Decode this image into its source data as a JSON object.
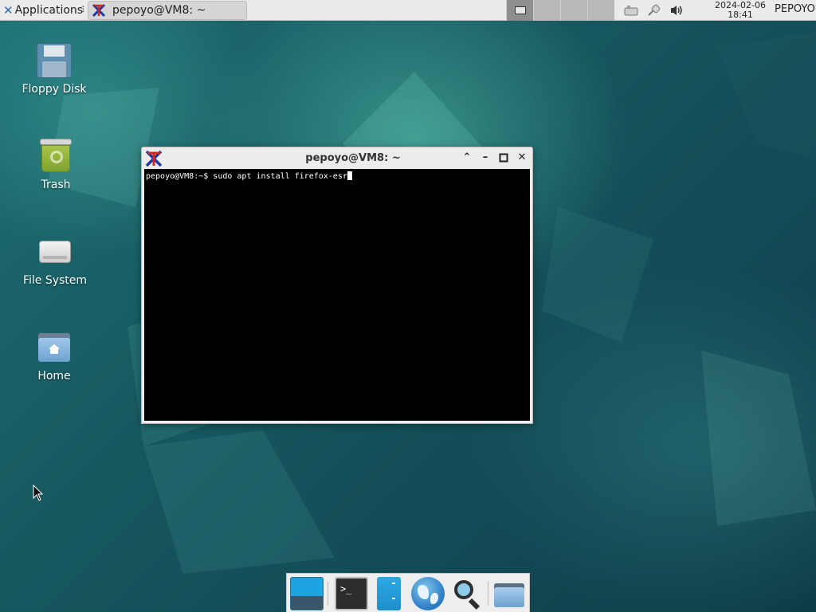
{
  "top_panel": {
    "applications_label": "Applications",
    "applications_separator": "⠇",
    "task_button_title": "pepoyo@VM8: ~",
    "clock": {
      "date": "2024-02-06",
      "time": "18:41"
    },
    "user_label": "PEPOYO"
  },
  "desktop_icons": [
    {
      "label": "Floppy Disk",
      "icon": "floppy-disk-icon"
    },
    {
      "label": "Trash",
      "icon": "trash-icon"
    },
    {
      "label": "File System",
      "icon": "hard-drive-icon"
    },
    {
      "label": "Home",
      "icon": "home-folder-icon"
    }
  ],
  "terminal": {
    "title": "pepoyo@VM8: ~",
    "prompt": "pepoyo@VM8:~$ ",
    "command": "sudo apt install firefox-esr"
  },
  "dock": {
    "items": [
      "show-desktop",
      "terminal-emulator",
      "file-manager",
      "web-browser",
      "app-finder",
      "folder"
    ]
  }
}
